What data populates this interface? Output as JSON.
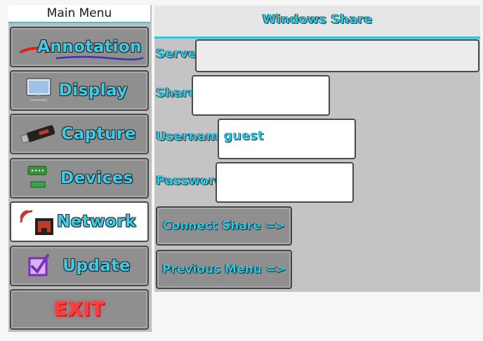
{
  "sidebar": {
    "title": "Main Menu",
    "items": [
      {
        "label": "Annotation",
        "icon": "pen-icon"
      },
      {
        "label": "Display",
        "icon": "monitor-icon"
      },
      {
        "label": "Capture",
        "icon": "usb-stick-icon"
      },
      {
        "label": "Devices",
        "icon": "serial-port-icon"
      },
      {
        "label": "Network",
        "icon": "ethernet-port-icon",
        "active": true
      },
      {
        "label": "Update",
        "icon": "checkbox-icon"
      },
      {
        "label": "EXIT",
        "icon": "exit-icon"
      }
    ]
  },
  "panel": {
    "title": "Windows Share",
    "fields": {
      "server": {
        "label": "Server",
        "value": ""
      },
      "share": {
        "label": "Share",
        "value": ""
      },
      "username": {
        "label": "Username",
        "value": "guest"
      },
      "password": {
        "label": "Password",
        "value": ""
      }
    },
    "buttons": {
      "connect": "Connect Share =>",
      "previous": "Previous Menu =>"
    }
  },
  "colors": {
    "accent": "#2fc6e3",
    "exit": "#ff3b3b",
    "button_gray": "#8f8f8f",
    "panel_gray": "#c4c4c4"
  }
}
